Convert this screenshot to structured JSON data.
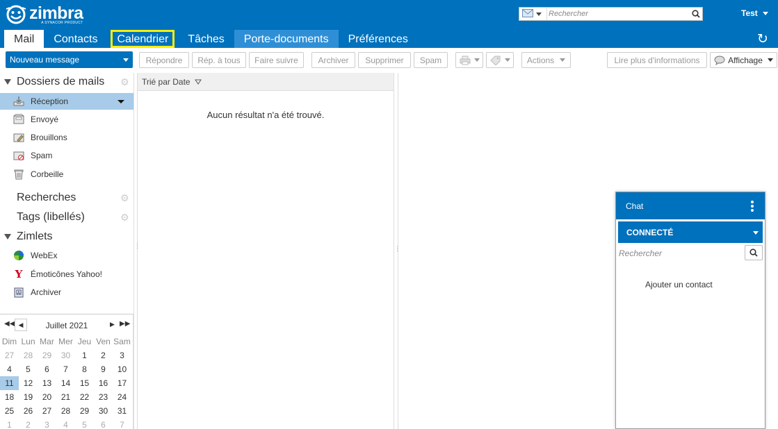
{
  "header": {
    "logo_word": "zimbra",
    "logo_sub": "A SYNACOR PRODUCT",
    "search_placeholder": "Rechercher",
    "user_name": "Test",
    "colors": {
      "brand": "#0071bc",
      "selected_tab": "#2f8fd6",
      "highlight": "#ffee00",
      "selection": "#a7cbe8"
    }
  },
  "app_tabs": [
    {
      "label": "Mail",
      "state": "active"
    },
    {
      "label": "Contacts",
      "state": "normal"
    },
    {
      "label": "Calendrier",
      "state": "highlighted"
    },
    {
      "label": "Tâches",
      "state": "normal"
    },
    {
      "label": "Porte-documents",
      "state": "selected"
    },
    {
      "label": "Préférences",
      "state": "normal"
    }
  ],
  "toolbar": {
    "new_message": "Nouveau message",
    "reply": "Répondre",
    "reply_all": "Rép. à tous",
    "forward": "Faire suivre",
    "archive": "Archiver",
    "delete": "Supprimer",
    "spam": "Spam",
    "actions": "Actions",
    "read_more": "Lire plus d'informations",
    "view": "Affichage",
    "print_icon": "printer-icon",
    "tag_icon": "tag-icon"
  },
  "sidebar": {
    "mail_folders_title": "Dossiers de mails",
    "folders": [
      {
        "label": "Réception",
        "icon": "inbox-icon",
        "selected": true
      },
      {
        "label": "Envoyé",
        "icon": "sent-icon",
        "selected": false
      },
      {
        "label": "Brouillons",
        "icon": "drafts-icon",
        "selected": false
      },
      {
        "label": "Spam",
        "icon": "spam-icon",
        "selected": false
      },
      {
        "label": "Corbeille",
        "icon": "trash-icon",
        "selected": false
      }
    ],
    "searches_title": "Recherches",
    "tags_title": "Tags (libellés)",
    "zimlets_title": "Zimlets",
    "zimlets": [
      {
        "label": "WebEx",
        "icon": "webex-icon"
      },
      {
        "label": "Émoticônes Yahoo!",
        "icon": "yahoo-icon"
      },
      {
        "label": "Archiver",
        "icon": "archive-icon"
      }
    ]
  },
  "calendar": {
    "month_label": "Juillet 2021",
    "weekdays": [
      "Dim",
      "Lun",
      "Mar",
      "Mer",
      "Jeu",
      "Ven",
      "Sam"
    ],
    "weeks": [
      [
        {
          "d": "27",
          "m": "o"
        },
        {
          "d": "28",
          "m": "o"
        },
        {
          "d": "29",
          "m": "o"
        },
        {
          "d": "30",
          "m": "o"
        },
        {
          "d": "1",
          "m": "c"
        },
        {
          "d": "2",
          "m": "c"
        },
        {
          "d": "3",
          "m": "c"
        }
      ],
      [
        {
          "d": "4",
          "m": "c"
        },
        {
          "d": "5",
          "m": "c"
        },
        {
          "d": "6",
          "m": "c"
        },
        {
          "d": "7",
          "m": "c"
        },
        {
          "d": "8",
          "m": "c"
        },
        {
          "d": "9",
          "m": "c"
        },
        {
          "d": "10",
          "m": "c"
        }
      ],
      [
        {
          "d": "11",
          "m": "t"
        },
        {
          "d": "12",
          "m": "c"
        },
        {
          "d": "13",
          "m": "c"
        },
        {
          "d": "14",
          "m": "c"
        },
        {
          "d": "15",
          "m": "c"
        },
        {
          "d": "16",
          "m": "c"
        },
        {
          "d": "17",
          "m": "c"
        }
      ],
      [
        {
          "d": "18",
          "m": "c"
        },
        {
          "d": "19",
          "m": "c"
        },
        {
          "d": "20",
          "m": "c"
        },
        {
          "d": "21",
          "m": "c"
        },
        {
          "d": "22",
          "m": "c"
        },
        {
          "d": "23",
          "m": "c"
        },
        {
          "d": "24",
          "m": "c"
        }
      ],
      [
        {
          "d": "25",
          "m": "c"
        },
        {
          "d": "26",
          "m": "c"
        },
        {
          "d": "27",
          "m": "c"
        },
        {
          "d": "28",
          "m": "c"
        },
        {
          "d": "29",
          "m": "c"
        },
        {
          "d": "30",
          "m": "c"
        },
        {
          "d": "31",
          "m": "c"
        }
      ],
      [
        {
          "d": "1",
          "m": "o"
        },
        {
          "d": "2",
          "m": "o"
        },
        {
          "d": "3",
          "m": "o"
        },
        {
          "d": "4",
          "m": "o"
        },
        {
          "d": "5",
          "m": "o"
        },
        {
          "d": "6",
          "m": "o"
        },
        {
          "d": "7",
          "m": "o"
        }
      ]
    ]
  },
  "message_list": {
    "sort_label": "Trié par Date",
    "empty_text": "Aucun résultat n'a été trouvé."
  },
  "chat": {
    "title": "Chat",
    "status": "CONNECTÉ",
    "search_placeholder": "Rechercher",
    "add_contact": "Ajouter un contact"
  }
}
